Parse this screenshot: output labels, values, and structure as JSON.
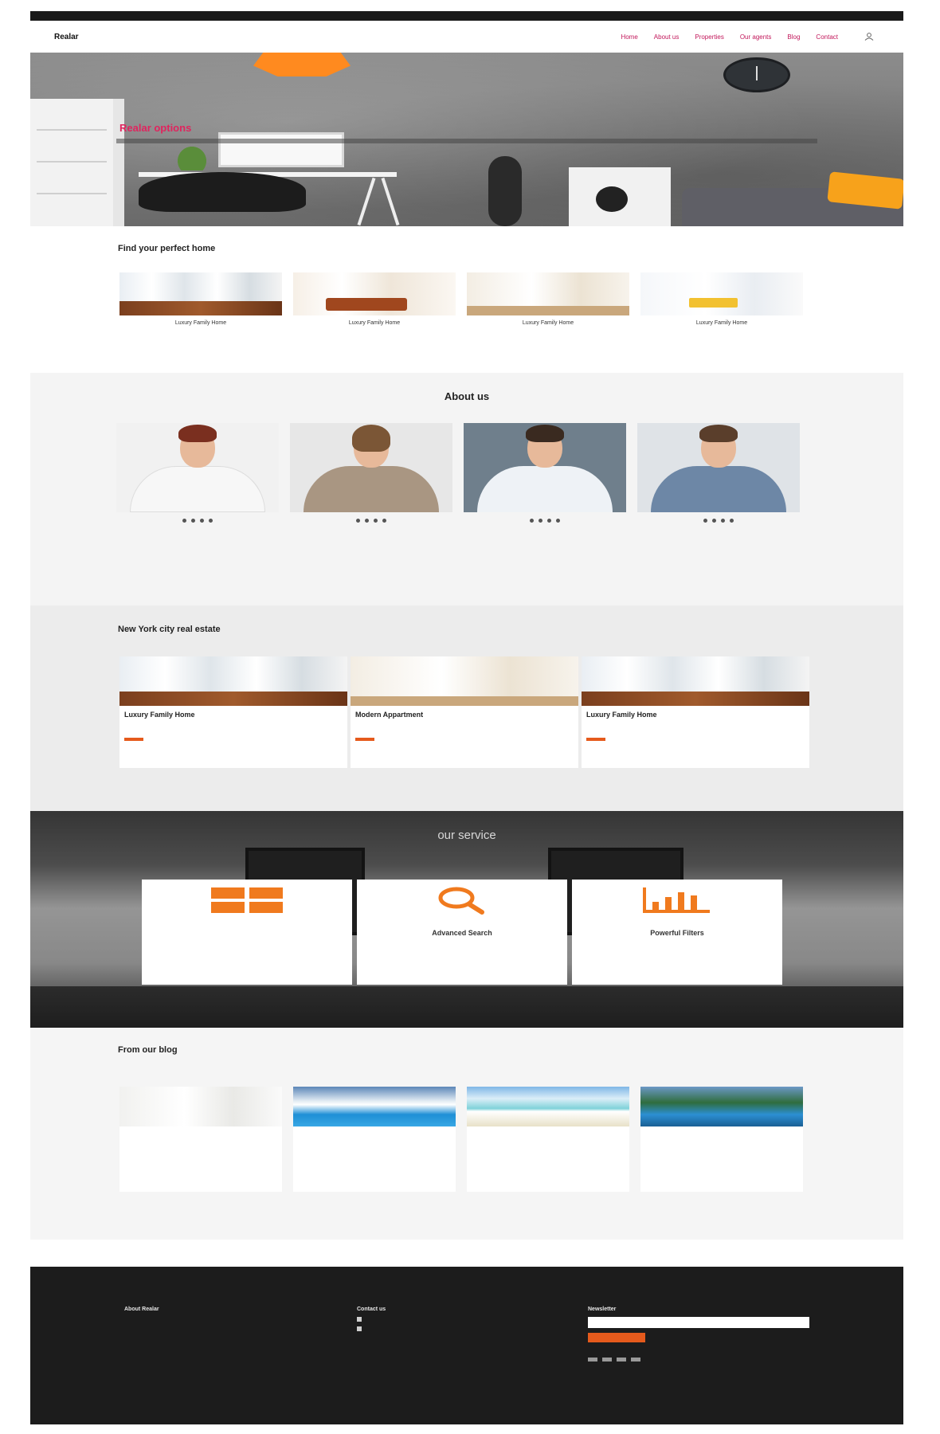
{
  "topbar": {
    "left_items": [
      "",
      "",
      "",
      ""
    ],
    "right_items": [
      "",
      ""
    ]
  },
  "header": {
    "logo": "Realar",
    "nav": [
      "Home",
      "About us",
      "Properties",
      "Our agents",
      "Blog",
      "Contact"
    ],
    "user_label": ""
  },
  "hero": {
    "title": "Realar options",
    "subtitle": ""
  },
  "find": {
    "title": "Find your perfect home",
    "cards": [
      {
        "caption": "Luxury Family Home",
        "sub": ""
      },
      {
        "caption": "Luxury Family Home",
        "sub": ""
      },
      {
        "caption": "Luxury Family Home",
        "sub": ""
      },
      {
        "caption": "Luxury Family Home",
        "sub": ""
      }
    ]
  },
  "about": {
    "title": "About us",
    "subtitle": "",
    "team": [
      {
        "name": "",
        "role": ""
      },
      {
        "name": "",
        "role": ""
      },
      {
        "name": "",
        "role": ""
      },
      {
        "name": "",
        "role": ""
      }
    ]
  },
  "listings": {
    "title": "New York city real estate",
    "items": [
      {
        "title": "Luxury Family Home",
        "address": "",
        "meta": "",
        "price": "",
        "button": ""
      },
      {
        "title": "Modern Appartment",
        "address": "",
        "meta": "",
        "price": "",
        "button": ""
      },
      {
        "title": "Luxury Family Home",
        "address": "",
        "meta": "",
        "price": "",
        "button": ""
      }
    ]
  },
  "service": {
    "title": "our service",
    "subtitle": "",
    "cards": [
      {
        "title": "",
        "desc": "",
        "link": "",
        "icon": "grid-icon"
      },
      {
        "title": "Advanced Search",
        "desc": "",
        "link": "",
        "icon": "search-icon"
      },
      {
        "title": "Powerful Filters",
        "desc": "",
        "link": "",
        "icon": "chart-icon"
      }
    ]
  },
  "blog": {
    "title": "From our blog",
    "subtitle": "",
    "posts": [
      {
        "title": "",
        "desc": "",
        "link": ""
      },
      {
        "title": "",
        "desc": "",
        "link": ""
      },
      {
        "title": "",
        "desc": "",
        "link": ""
      },
      {
        "title": "",
        "desc": "",
        "link": ""
      }
    ]
  },
  "footer": {
    "about_title": "About Realar",
    "about_text": "",
    "about_link": "",
    "contact_title": "Contact us",
    "contact_lines": [
      "",
      ""
    ],
    "contact_link": "",
    "newsletter_title": "Newsletter",
    "newsletter_placeholder": "",
    "newsletter_button": "",
    "newsletter_text": ""
  },
  "bottom": {
    "copyright": "",
    "powered": "",
    "right": ""
  },
  "colors": {
    "accent": "#e55a1c",
    "nav_link": "#c2185b",
    "hero_title": "#e0245e",
    "footer_bg": "#1c1c1c"
  }
}
